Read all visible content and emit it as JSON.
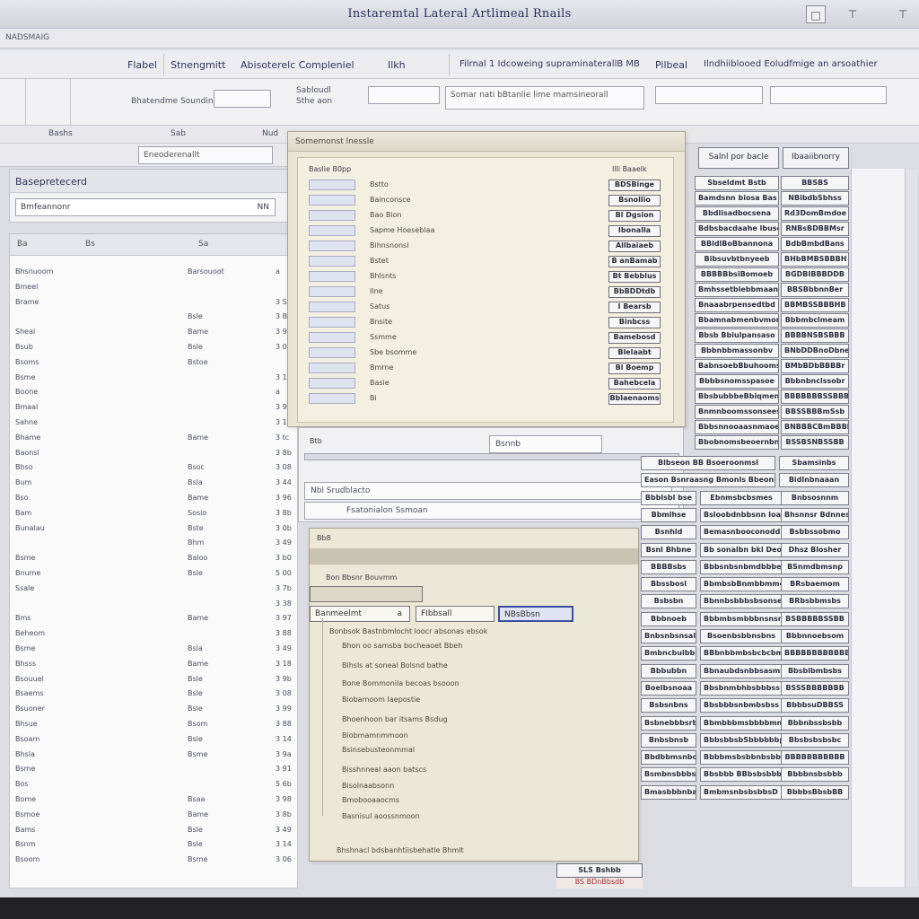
{
  "window": {
    "title": "Instaremtal Lateral Artlimeal Rnails"
  },
  "menubar": {
    "left_label": "NADSMAIG"
  },
  "toolbar": {
    "items": [
      "Flabel",
      "Stnengmitt",
      "Abisoterelc Compleniel",
      "Ilkh",
      "Filrnal 1 Idcoweing supraminaterallB MB",
      "Pilbeal",
      "Ilndhiiblooed Eoludfmige an arsoathier"
    ]
  },
  "ribbon": {
    "label_left": "Bhatendme Sounding",
    "box_a": "Sabloudl",
    "label_mid": "Sthe aon",
    "label_info": "Somar nati bBtanlie lime mamsineorall"
  },
  "subhead": {
    "a": "Bashs",
    "b": "Sab",
    "c": "Nud"
  },
  "filterbar": {
    "label": "Eneoderenallt"
  },
  "left_panel": {
    "title": "Basepretecerd",
    "input": "Bmfeannonr",
    "input_value": "NN"
  },
  "list": {
    "headers": [
      "Ba",
      "Bs",
      "Sa"
    ],
    "rows": [
      [
        "Bhsnuoom",
        "Barsouoot",
        ""
      ],
      [
        "Bmeel",
        "",
        ""
      ],
      [
        "Brame",
        "",
        "a"
      ],
      [
        "",
        "Bsle",
        ""
      ],
      [
        "Sheal",
        "Bame",
        ""
      ],
      [
        "Bsub",
        "Bsle",
        ""
      ],
      [
        "Bsoms",
        "Bstoe",
        ""
      ],
      [
        "Bsme",
        "",
        "a"
      ],
      [
        "Boone",
        "",
        "a"
      ],
      [
        "Bmaal",
        "",
        ""
      ],
      [
        "Sahne",
        "",
        ""
      ],
      [
        "Bhame",
        "Bame",
        ""
      ],
      [
        "Baonsl",
        "",
        ""
      ],
      [
        "Bhso",
        "Bsoc",
        ""
      ],
      [
        "Bum",
        "Bsla",
        ""
      ],
      [
        "Bso",
        "Bame",
        ""
      ],
      [
        "Bam",
        "Sosio",
        ""
      ],
      [
        "Bunalau",
        "Bste",
        ""
      ],
      [
        "",
        "Bhm",
        ""
      ],
      [
        "Bsme",
        "Baloo",
        ""
      ],
      [
        "Bnume",
        "Bsle",
        ""
      ],
      [
        "Ssale",
        "",
        ""
      ],
      [
        "",
        "",
        "a"
      ],
      [
        "Bms",
        "Bame",
        ""
      ],
      [
        "Beheom",
        "",
        ""
      ],
      [
        "Bsme",
        "Bsla",
        ""
      ],
      [
        "Bhsss",
        "Bame",
        ""
      ],
      [
        "Bsouuel",
        "Bsle",
        ""
      ],
      [
        "Bsaems",
        "Bsle",
        ""
      ],
      [
        "Bsuoner",
        "Bsle",
        ""
      ],
      [
        "Bhsue",
        "Bsom",
        ""
      ],
      [
        "Bsoam",
        "Bsle",
        ""
      ],
      [
        "Bhsla",
        "Bsme",
        ""
      ],
      [
        "Bsme",
        "",
        ""
      ],
      [
        "Bos",
        "",
        "a"
      ],
      [
        "Bome",
        "Bsaa",
        ""
      ],
      [
        "Bsmoe",
        "Bame",
        ""
      ],
      [
        "Bams",
        "Bsle",
        ""
      ],
      [
        "Bsnm",
        "Bsle",
        ""
      ],
      [
        "Bsoom",
        "Bsme",
        ""
      ]
    ],
    "values": [
      "a",
      "",
      "3 S1",
      "3 B8",
      "3 9b",
      "3 08",
      "",
      "3 11",
      "a",
      "3 9a",
      "3 10",
      "3 tc",
      "3 8b",
      "3 08",
      "3 44",
      "3 96",
      "3 8b",
      "3 0b",
      "3 49",
      "3 b0",
      "5 00",
      "3 7b",
      "3 38",
      "3 97",
      "3 88",
      "3 49",
      "3 18",
      "3 9b",
      "3 08",
      "3 99",
      "3 88",
      "3 14",
      "3 9a",
      "3 91",
      "5 6b",
      "3 98",
      "3 8b",
      "3 49",
      "3 14",
      "3 06"
    ]
  },
  "dialog_main": {
    "title": "Somemonst lnessle",
    "header_left": "Baslie B0pp",
    "header_right": "Illi Baaelk",
    "items": [
      "Bstto",
      "Bainconsce",
      "Bao Bion",
      "Sapme Hoeseblaa",
      "Bihnsnonsl",
      "Bstet",
      "Bhlsnts",
      "Ilne",
      "Satus",
      "Bnsite",
      "Ssmme",
      "Sbe bsomme",
      "Bmrne",
      "Basie",
      "Bi"
    ],
    "buttons": [
      "BDSBinge",
      "Bsnollio",
      "Bl Dgsion",
      "Ibonalla",
      "Allbaiaeb",
      "B anBamab",
      "Bt Bebblus",
      "BbBDDtdb",
      "I Bearsb",
      "Binbcss",
      "Bamebosd",
      "Blelaabt",
      "Bl Boemp",
      "Bahebcela",
      "Bblaenaoms"
    ]
  },
  "dialog_search": {
    "label": "Btb",
    "field1": "Bsnnb",
    "field2": "Nbl Srudblacto",
    "field3": "Fsatonialon Ssmoan"
  },
  "dialog_detail": {
    "title": "Bb8",
    "heading": "Bon Bbsnr Bouvmm",
    "field_a": "Banmeelmt",
    "field_b": "FIbbsall",
    "field_c": "NBsBbsn",
    "field_a_value": "a",
    "lines": [
      "Bonbsok Bastnbmlocht loocr absonas ebsok",
      "Bhon oo samsba bocheaoet Bbeh",
      "Blhsls at soneal Bolsnd bathe",
      "Bone Bommonila becoas bsooon",
      "Biobamoom Iaepostie",
      "Bhoenhoon bar itsams Bsdug",
      "Biobmamnmmoon",
      "Bsinsebusteonmmal",
      "Bisshnneal aaon batscs",
      "Bisolnaabsonn",
      "Bmobooaaocms",
      "Basnisul aoossnmoon",
      "Bhshnacl bdsbanhtiisbehatle Bhmlt"
    ]
  },
  "grid": {
    "headers": [
      "Salnl por bacle",
      "Ibaaiibnorry"
    ],
    "rows": [
      [
        "Sbseldmt Bstb",
        "BBSBS"
      ],
      [
        "Bamdsnn biosa Bas",
        "NBibdbSbhss"
      ],
      [
        "Bbdlisadbocsena",
        "Rd3DomBmdoe"
      ],
      [
        "Bdbsbacdaahe lbuse",
        "RNBsBDBBMsr"
      ],
      [
        "BBldlBoBbannona",
        "BdbBmbdBans"
      ],
      [
        "Bibsuvbtbnyeeb",
        "BHbBMBSBBBH"
      ],
      [
        "BBBBBbsiBomoeb",
        "BGDBIBBBDDB"
      ],
      [
        "Bmhssetblebbmaan",
        "BBSBbbnnBer"
      ],
      [
        "Bnaaabrpensedtbd",
        "BBMBSSBBBHB"
      ],
      [
        "Bbamnabmenbvmona",
        "Bbbmbclmeam"
      ],
      [
        "Bbsb Bbiulpansaso",
        "BBBBNSBSBBB"
      ],
      [
        "Bbbnbbmassonbv",
        "BNbDDBnoDbne"
      ],
      [
        "BabnsoebBbuhoomson",
        "BMbBDbBBBBr"
      ],
      [
        "Bbbbsnomsspasoe",
        "Bbbnbnclssobr"
      ],
      [
        "BbsbubbbeBbiqmena",
        "BBBBBBBSSBBB"
      ],
      [
        "Bnmnboomssonsees",
        "BBSSBBBmSsb"
      ],
      [
        "Bbbsnnooaasnmaoe",
        "BNBBBCBmBBBE"
      ],
      [
        "Bbobnomsbeoernbn",
        "BSSBSNBSSBB"
      ]
    ],
    "rows_lower": [
      [
        "Blbseon BB Bsoeroonmsl",
        "Sbamsinbs"
      ],
      [
        "Eason Bsnraasng Bmonls Bbeonsboss",
        "Bidlnbnaaan"
      ],
      [
        "Bbblsbl bse",
        "Ebnmsbcbsmes",
        "Bnbsosnnm"
      ],
      [
        "Bbmlhse",
        "Bsloobdnbbsnn Ioaa",
        "Bhsnnsr Bdnnes"
      ],
      [
        "Bsnhld",
        "Bemasnbooconoddb",
        "Bsbbssobmo"
      ],
      [
        "Bsnl Bhbne",
        "Bb sonalbn bkl Deoe",
        "Dhsz Blosher"
      ],
      [
        "BBBBsbs",
        "Bbbsnbsnbmdbbbe",
        "BSnmdbmsnp"
      ],
      [
        "Bbssbosl",
        "BbmbsbBnmbbmmone",
        "BRsbaemom"
      ],
      [
        "Bsbsbn",
        "Bbnnbsbbbsbsonse",
        "BRbsbbmsbs"
      ],
      [
        "Bbbnoeb",
        "Bbbmbsmbbbnsnsnb",
        "BSBBBBBSSBB"
      ],
      [
        "Bnbsnbsnsal",
        "Bsoenbsbbnsbns",
        "Bbbnnoebsom"
      ],
      [
        "Bmbncbuibbhdb",
        "BBbnbbmbsbcbcbmd",
        "BBBBBBBBBBBB"
      ],
      [
        "Bbbubbn",
        "Bbnaubdsnbbsasms",
        "Bbsblbmbsbs"
      ],
      [
        "Boelbsnoaa",
        "Bbsbnmbhbsbbbss",
        "BSSSBBBBBBB"
      ],
      [
        "Bsbsnbns",
        "Bbsbbbsnbmbsbss",
        "BbbbsuDBBSS"
      ],
      [
        "Bsbnebbbsrb",
        "Bbmbbbmsbbbbmmaoe",
        "Bbbnbssbsbb"
      ],
      [
        "Bnbsbnsb",
        "BbbsbbsbSbbbbbbp",
        "Bbsbsbsbsbc"
      ],
      [
        "Bbdbbmsnbobs",
        "Bbbbmsbsbbnbsbbd",
        "BBBBBBBBBBB"
      ],
      [
        "Bsmbnsbbbsb",
        "Bbsbbb BBbsbsbbbmso",
        "Bbbbnsbsbbb"
      ],
      [
        "Bmasbbbnbaom",
        "BmbmsnbsbsbbsD Bdsb",
        "BbbbsBbsbBB"
      ]
    ]
  },
  "status": {
    "primary": "SLS Bshbb",
    "secondary": "BS BDnBbsdb"
  }
}
